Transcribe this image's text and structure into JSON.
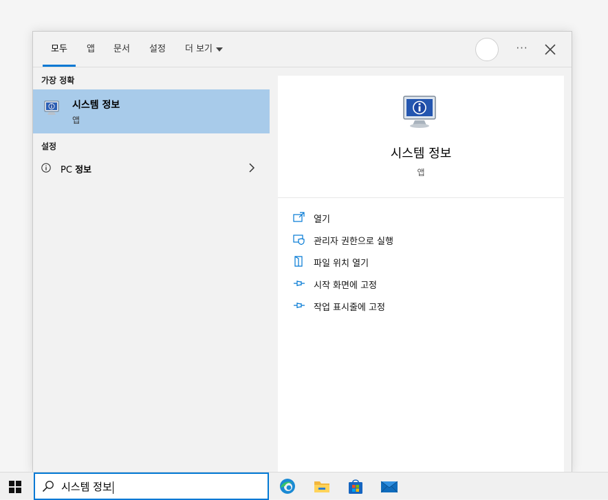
{
  "tabs": [
    {
      "label": "모두"
    },
    {
      "label": "앱"
    },
    {
      "label": "문서"
    },
    {
      "label": "설정"
    },
    {
      "label": "더 보기"
    }
  ],
  "header": {
    "more_icon": "more-dots",
    "close_icon": "close"
  },
  "left": {
    "best_match_title": "가장 정확",
    "best_match": {
      "name": "시스템 정보",
      "type": "앱",
      "icon": "system-information-icon"
    },
    "settings_title": "설정",
    "settings_item": {
      "prefix": "PC",
      "label": "정보",
      "icon": "info-icon"
    }
  },
  "right": {
    "title": "시스템 정보",
    "subtitle": "앱",
    "actions": [
      {
        "label": "열기",
        "icon": "open-icon"
      },
      {
        "label": "관리자 권한으로 실행",
        "icon": "admin-shield-icon"
      },
      {
        "label": "파일 위치 열기",
        "icon": "file-location-icon"
      },
      {
        "label": "시작 화면에 고정",
        "icon": "pin-icon"
      },
      {
        "label": "작업 표시줄에 고정",
        "icon": "pin-icon"
      }
    ]
  },
  "taskbar": {
    "search_value": "시스템 정보",
    "apps": [
      "edge-icon",
      "file-explorer-icon",
      "store-icon",
      "mail-icon"
    ]
  },
  "colors": {
    "accent": "#0078d4",
    "selected": "#a8cbea"
  }
}
